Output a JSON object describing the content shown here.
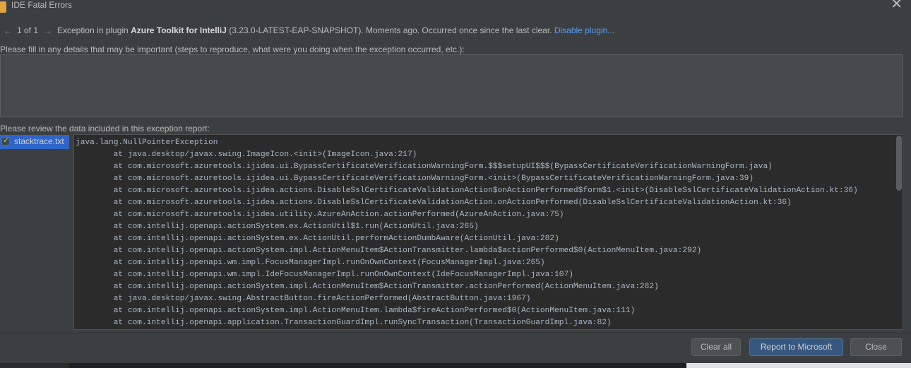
{
  "window": {
    "title": "IDE Fatal Errors",
    "close_glyph": "✕"
  },
  "nav": {
    "prev_glyph": "←",
    "next_glyph": "→",
    "counter": "1 of 1",
    "message_prefix": "Exception in plugin ",
    "plugin_name": "Azure Toolkit for IntelliJ",
    "message_suffix": " (3.23.0-LATEST-EAP-SNAPSHOT). Moments ago. Occurred once since the last clear. ",
    "disable_link": "Disable plugin..."
  },
  "details": {
    "label": "Please fill in any details that may be important (steps to reproduce, what were you doing when the exception occurred, etc.):",
    "value": ""
  },
  "report": {
    "label": "Please review the data included in this exception report:",
    "files": [
      {
        "name": "stacktrace.txt",
        "checked": true
      }
    ]
  },
  "stacktrace": [
    "java.lang.NullPointerException",
    "\tat java.desktop/javax.swing.ImageIcon.<init>(ImageIcon.java:217)",
    "\tat com.microsoft.azuretools.ijidea.ui.BypassCertificateVerificationWarningForm.$$$setupUI$$$(BypassCertificateVerificationWarningForm.java)",
    "\tat com.microsoft.azuretools.ijidea.ui.BypassCertificateVerificationWarningForm.<init>(BypassCertificateVerificationWarningForm.java:39)",
    "\tat com.microsoft.azuretools.ijidea.actions.DisableSslCertificateValidationAction$onActionPerformed$form$1.<init>(DisableSslCertificateValidationAction.kt:36)",
    "\tat com.microsoft.azuretools.ijidea.actions.DisableSslCertificateValidationAction.onActionPerformed(DisableSslCertificateValidationAction.kt:36)",
    "\tat com.microsoft.azuretools.ijidea.utility.AzureAnAction.actionPerformed(AzureAnAction.java:75)",
    "\tat com.intellij.openapi.actionSystem.ex.ActionUtil$1.run(ActionUtil.java:265)",
    "\tat com.intellij.openapi.actionSystem.ex.ActionUtil.performActionDumbAware(ActionUtil.java:282)",
    "\tat com.intellij.openapi.actionSystem.impl.ActionMenuItem$ActionTransmitter.lambda$actionPerformed$0(ActionMenuItem.java:292)",
    "\tat com.intellij.openapi.wm.impl.FocusManagerImpl.runOnOwnContext(FocusManagerImpl.java:265)",
    "\tat com.intellij.openapi.wm.impl.IdeFocusManagerImpl.runOnOwnContext(IdeFocusManagerImpl.java:107)",
    "\tat com.intellij.openapi.actionSystem.impl.ActionMenuItem$ActionTransmitter.actionPerformed(ActionMenuItem.java:282)",
    "\tat java.desktop/javax.swing.AbstractButton.fireActionPerformed(AbstractButton.java:1967)",
    "\tat com.intellij.openapi.actionSystem.impl.ActionMenuItem.lambda$fireActionPerformed$0(ActionMenuItem.java:111)",
    "\tat com.intellij.openapi.application.TransactionGuardImpl.runSyncTransaction(TransactionGuardImpl.java:82)"
  ],
  "buttons": {
    "clear_all": "Clear all",
    "report": "Report to Microsoft",
    "close": "Close"
  },
  "colors": {
    "dialog_bg": "#3c3f41",
    "editor_bg": "#2b2b2b",
    "selection": "#2f65ca",
    "link": "#589df6",
    "primary_button": "#365880"
  },
  "icons": {
    "app": "app-icon",
    "close": "close-icon",
    "prev": "arrow-left-icon",
    "next": "arrow-right-icon",
    "checkbox": "checkmark-icon"
  }
}
